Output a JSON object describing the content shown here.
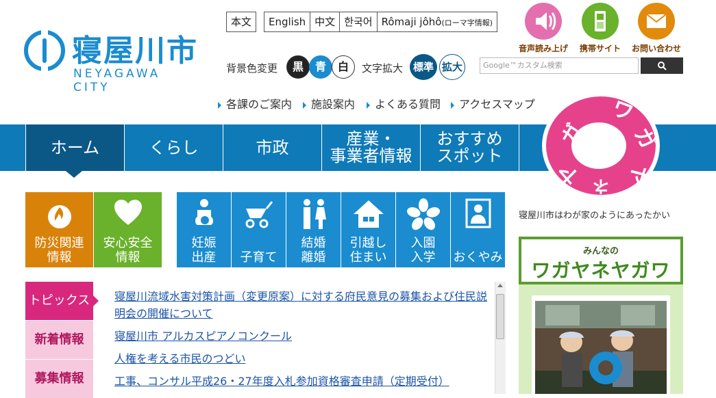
{
  "logo": {
    "name": "寝屋川市",
    "en": "NEYAGAWA CITY"
  },
  "lang": {
    "main": "本文",
    "items": [
      "English",
      "中文",
      "한국어",
      "Rômaji jôhô"
    ],
    "romaji_note": "(ローマ字情報)"
  },
  "bg": {
    "label": "背景色変更",
    "options": [
      "黒",
      "青",
      "白"
    ]
  },
  "text_size": {
    "label": "文字拡大",
    "options": [
      "標準",
      "拡大"
    ]
  },
  "top_icons": [
    {
      "label": "音声読み上げ",
      "icon": "speaker-icon",
      "color": "#e46fae"
    },
    {
      "label": "携帯サイト",
      "icon": "mobile-phone-icon",
      "color": "#6ab12c"
    },
    {
      "label": "お問い合わせ",
      "icon": "mail-icon",
      "color": "#e18a0c"
    }
  ],
  "search": {
    "placeholder": "Google™カスタム検索"
  },
  "sublinks": [
    "各課のご案内",
    "施設案内",
    "よくある質問",
    "アクセスマップ"
  ],
  "nav": [
    "ホーム",
    "くらし",
    "市政",
    "産業・\n事業者情報",
    "おすすめ\nスポット"
  ],
  "mascot": {
    "chars": [
      "ワ",
      "ガ",
      "ヤ",
      "ネ",
      "ヤ",
      "ガ"
    ],
    "caption": "寝屋川市はわが家のようにあったかい"
  },
  "tiles_left": [
    {
      "label": "防災関連\n情報",
      "color": "#d9820a",
      "icon": "fire-icon"
    },
    {
      "label": "安心安全\n情報",
      "color": "#6ab12c",
      "icon": "heart-icon"
    }
  ],
  "tiles_blue": [
    {
      "label": "妊娠\n出産",
      "icon": "pregnancy-icon"
    },
    {
      "label": "子育て",
      "icon": "stroller-icon"
    },
    {
      "label": "結婚\n離婚",
      "icon": "couple-icon"
    },
    {
      "label": "引越し\n住まい",
      "icon": "house-icon"
    },
    {
      "label": "入園\n入学",
      "icon": "cherry-blossom-icon"
    },
    {
      "label": "おくやみ",
      "icon": "memorial-icon"
    }
  ],
  "tabs": [
    "トピックス",
    "新着情報",
    "募集情報"
  ],
  "topics": [
    "寝屋川流域水害対策計画（変更原案）に対する府民意見の募集および住民説明会の開催について",
    "寝屋川市 アルカスピアノコンクール",
    "人権を考える市民のつどい",
    "工事、コンサル平成26・27年度入札参加資格審査申請（定期受付）"
  ],
  "widget": {
    "small": "みんなの",
    "title": "ワガヤネヤガワ"
  },
  "colors": {
    "nav": "#0f7ab8",
    "nav_active": "#0b5887",
    "pink": "#d8287e",
    "pink_light": "#f6c9df",
    "accent": "#1a8ccf"
  }
}
